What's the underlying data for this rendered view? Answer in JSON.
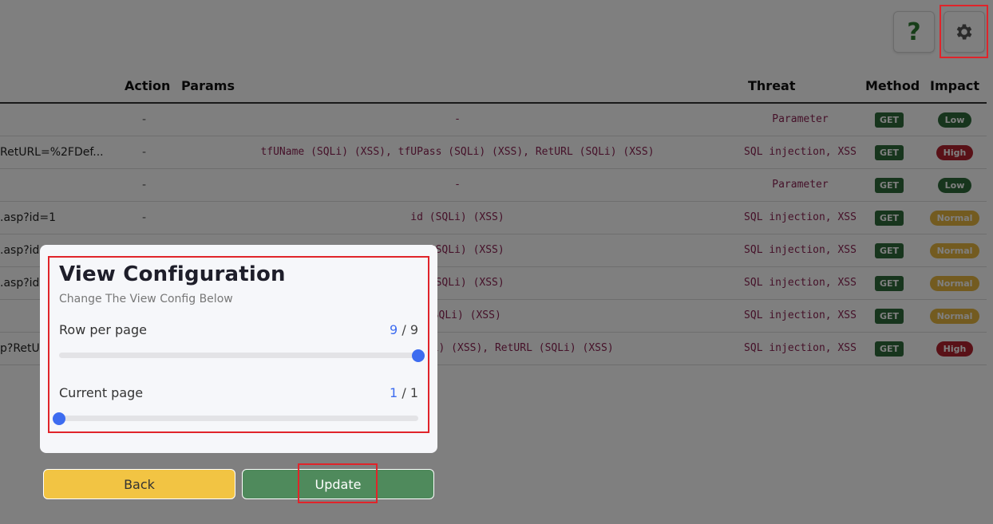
{
  "toolbar": {
    "help_glyph": "?",
    "settings_icon": "gear-icon"
  },
  "table": {
    "headers": {
      "action": "Action",
      "params": "Params",
      "threat": "Threat",
      "method": "Method",
      "impact": "Impact"
    },
    "rows": [
      {
        "url": "",
        "action": "-",
        "params": "-",
        "threat": "Parameter",
        "method": "GET",
        "impact": "Low",
        "impact_class": "low"
      },
      {
        "url": "RetURL=%2FDef...",
        "action": "-",
        "params": "tfUName (SQLi) (XSS), tfUPass (SQLi) (XSS), RetURL (SQLi) (XSS)",
        "threat": "SQL injection, XSS",
        "method": "GET",
        "impact": "High",
        "impact_class": "high"
      },
      {
        "url": "",
        "action": "-",
        "params": "-",
        "threat": "Parameter",
        "method": "GET",
        "impact": "Low",
        "impact_class": "low"
      },
      {
        "url": ".asp?id=1",
        "action": "-",
        "params": "id (SQLi) (XSS)",
        "threat": "SQL injection, XSS",
        "method": "GET",
        "impact": "Normal",
        "impact_class": "normal"
      },
      {
        "url": ".asp?id",
        "action": "",
        "params": "id (SQLi) (XSS)",
        "threat": "SQL injection, XSS",
        "method": "GET",
        "impact": "Normal",
        "impact_class": "normal"
      },
      {
        "url": ".asp?id",
        "action": "",
        "params": "id (SQLi) (XSS)",
        "threat": "SQL injection, XSS",
        "method": "GET",
        "impact": "Normal",
        "impact_class": "normal"
      },
      {
        "url": "",
        "action": "",
        "params": "h (SQLi) (XSS)",
        "threat": "SQL injection, XSS",
        "method": "GET",
        "impact": "Normal",
        "impact_class": "normal"
      },
      {
        "url": "p?RetU",
        "action": "",
        "params": "tfEmail, tfUPass (SQLi) (XSS), RetURL (SQLi) (XSS)",
        "threat": "SQL injection, XSS",
        "method": "GET",
        "impact": "High",
        "impact_class": "high"
      }
    ]
  },
  "modal": {
    "title": "View Configuration",
    "subtitle": "Change The View Config Below",
    "rows_per_page": {
      "label": "Row per page",
      "current": "9",
      "separator": "/",
      "total": "9",
      "fraction": 1.0
    },
    "current_page": {
      "label": "Current page",
      "current": "1",
      "separator": "/",
      "total": "1",
      "fraction": 0.0
    },
    "back_label": "Back",
    "update_label": "Update"
  },
  "colors": {
    "accent_blue": "#3d6cf0",
    "back_yellow": "#f2c443",
    "update_green": "#4f8a5c",
    "highlight_red": "#e0242a"
  }
}
